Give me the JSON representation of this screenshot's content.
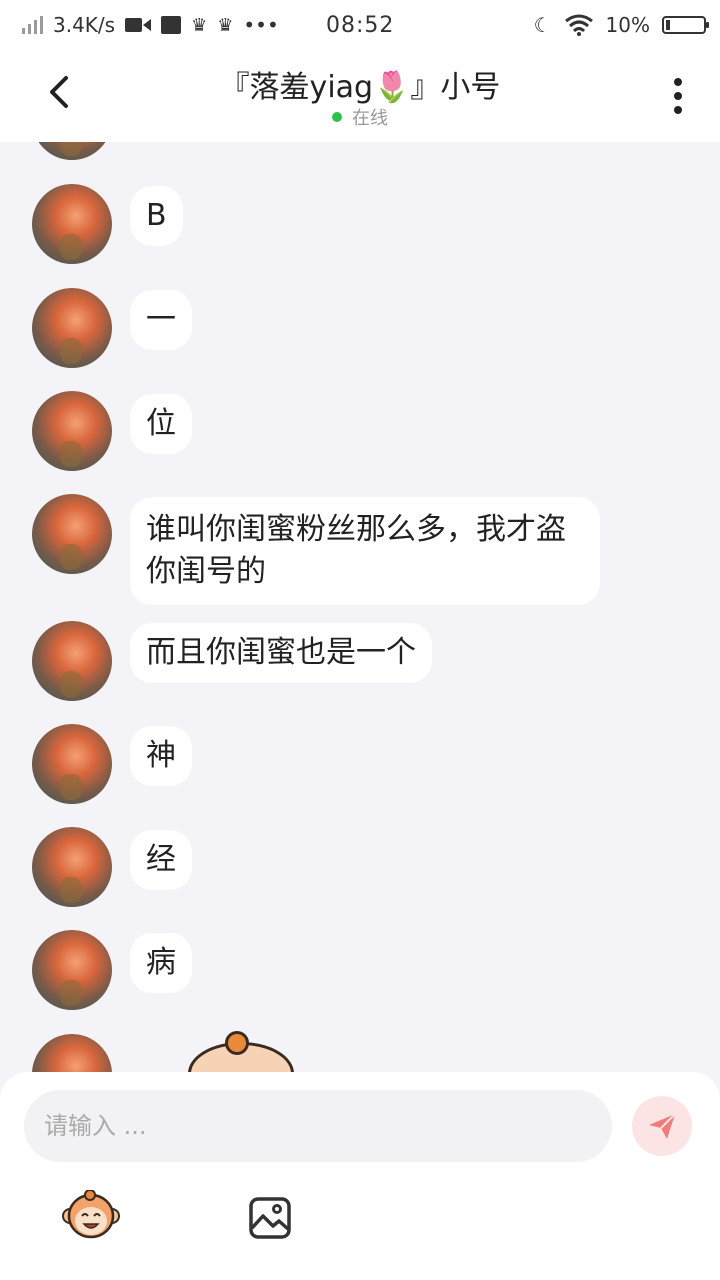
{
  "status_bar": {
    "network_speed": "3.4K/s",
    "time": "08:52",
    "battery": "10%",
    "battery_level": 0.1
  },
  "header": {
    "title": "『落羞yiag🌷』小号",
    "status": "在线"
  },
  "messages": [
    {
      "sender": "other",
      "text": "B"
    },
    {
      "sender": "other",
      "text": "一"
    },
    {
      "sender": "other",
      "text": "位"
    },
    {
      "sender": "other",
      "text": "谁叫你闺蜜粉丝那么多，我才盗你闺号的"
    },
    {
      "sender": "other",
      "text": "而且你闺蜜也是一个"
    },
    {
      "sender": "other",
      "text": "神"
    },
    {
      "sender": "other",
      "text": "经"
    },
    {
      "sender": "other",
      "text": "病"
    }
  ],
  "input": {
    "placeholder": "请输入 ..."
  },
  "colors": {
    "background": "#f4f4f8",
    "online": "#2ec24a",
    "send_button": "#fde4e4",
    "send_icon": "#f07b7b"
  }
}
